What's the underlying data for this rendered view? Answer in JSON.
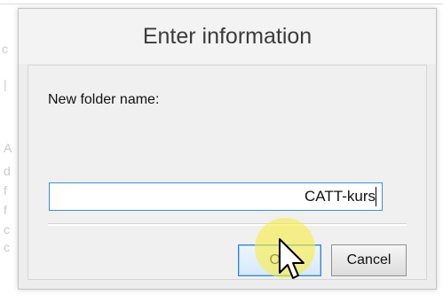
{
  "dialog": {
    "title": "Enter information",
    "prompt": "New folder name:",
    "input_value": "CATT-kurs",
    "ok_label": "OK",
    "cancel_label": "Cancel"
  },
  "colors": {
    "dialog_bg": "#ededed",
    "input_border": "#3a8ee6",
    "ok_border": "#2e86d6",
    "click_highlight": "#f8ee46"
  },
  "icons": {
    "cursor": "mouse-pointer-icon"
  }
}
